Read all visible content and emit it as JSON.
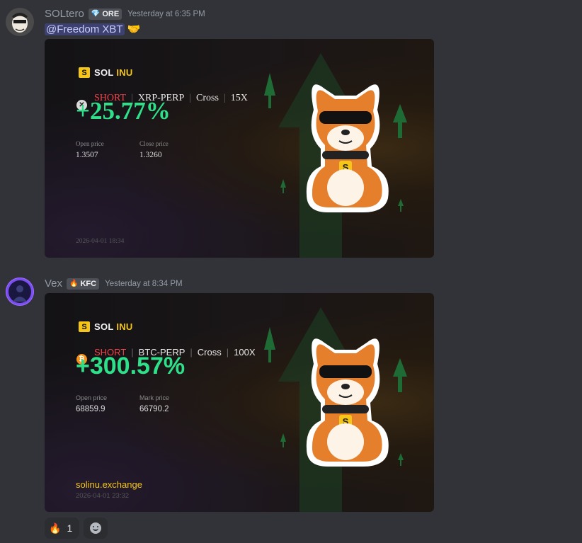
{
  "messages": [
    {
      "username": "SOLtero",
      "tag": {
        "icon": "diamond-icon",
        "label": "ORE"
      },
      "timestamp": "Yesterday at 6:35 PM",
      "mention": "@Freedom XBT",
      "emoji": "🤝",
      "card": {
        "brand_sol": "SOL",
        "brand_inu": "INU",
        "brand_logo": "S",
        "coin_icon": "x-icon",
        "side": "SHORT",
        "pair": "XRP-PERP",
        "margin": "Cross",
        "leverage": "15X",
        "pnl": "+25.77%",
        "price1_label": "Open price",
        "price1_value": "1.3507",
        "price2_label": "Close price",
        "price2_value": "1.3260",
        "datetime": "2026-04-01 18:34"
      }
    },
    {
      "username": "Vex",
      "tag": {
        "icon": "fire-icon",
        "label": "KFC"
      },
      "timestamp": "Yesterday at 8:34 PM",
      "card": {
        "brand_sol": "SOL",
        "brand_inu": "INU",
        "brand_logo": "S",
        "coin_icon": "bitcoin-icon",
        "coin_glyph": "₿",
        "side": "SHORT",
        "pair": "BTC-PERP",
        "margin": "Cross",
        "leverage": "100X",
        "pnl": "+300.57%",
        "price1_label": "Open price",
        "price1_value": "68859.9",
        "price2_label": "Mark price",
        "price2_value": "66790.2",
        "site": "solinu.exchange",
        "datetime": "2026-04-01 23:32"
      }
    }
  ],
  "reactions": [
    {
      "emoji": "🔥",
      "count": "1"
    }
  ],
  "colors": {
    "background": "#313338",
    "profit_green": "#2fe08a",
    "short_red": "#f0424a",
    "brand_yellow": "#f5c518"
  }
}
